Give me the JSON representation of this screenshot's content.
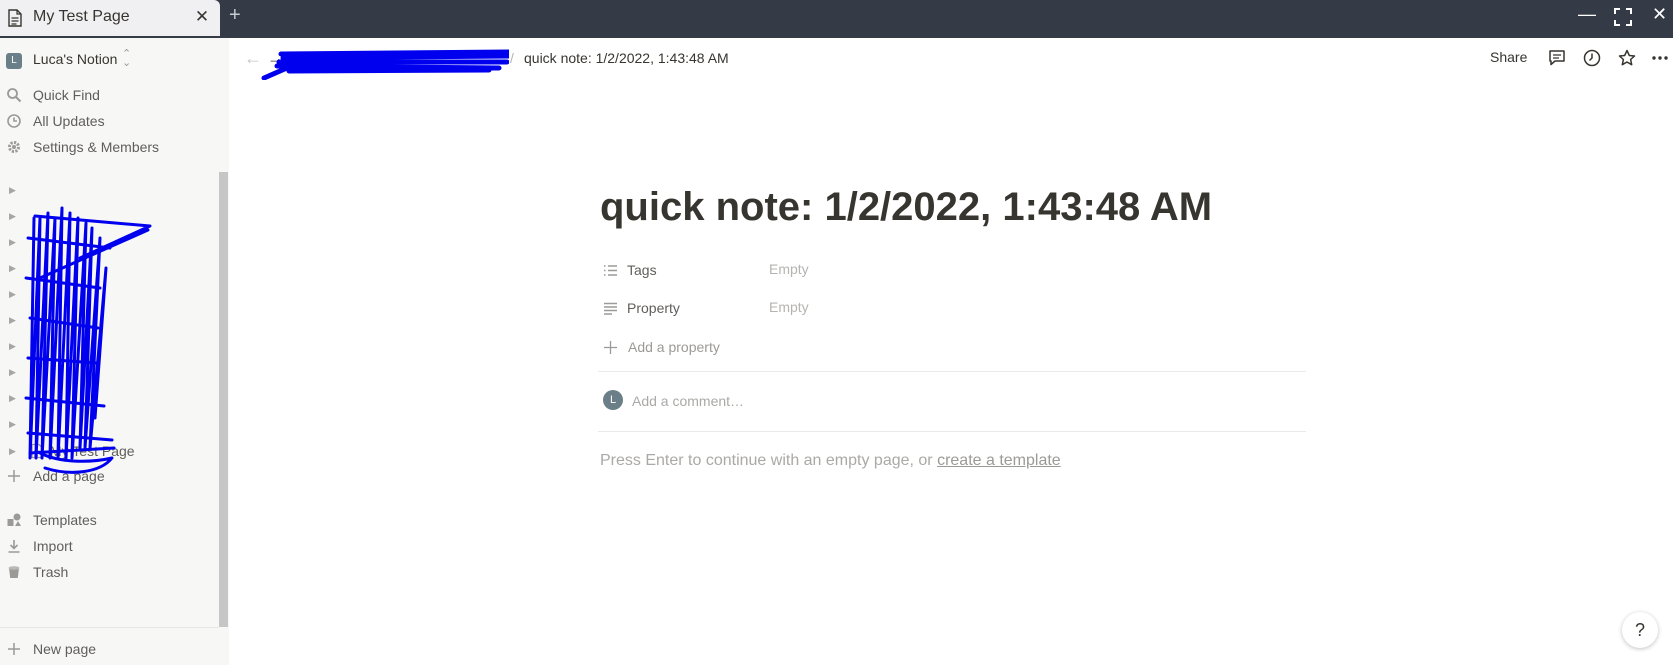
{
  "tabbar": {
    "tab_title": "My Test Page",
    "close_glyph": "✕",
    "new_tab_glyph": "+",
    "window_controls": {
      "minimize": "—",
      "maximize": "⛶",
      "close": "✕"
    }
  },
  "sidebar": {
    "workspace": {
      "avatar_letter": "L",
      "name": "Luca's Notion",
      "switch_icon": "chevron-updown-icon"
    },
    "nav_items": [
      {
        "label": "Quick Find",
        "icon": "search-icon"
      },
      {
        "label": "All Updates",
        "icon": "clock-icon"
      },
      {
        "label": "Settings & Members",
        "icon": "gear-icon"
      }
    ],
    "tree_visible_page": {
      "label": "My Test Page",
      "icon": "page-icon"
    },
    "add_page_label": "Add a page",
    "bottom_items": [
      {
        "label": "Templates",
        "icon": "templates-icon"
      },
      {
        "label": "Import",
        "icon": "import-icon"
      },
      {
        "label": "Trash",
        "icon": "trash-icon"
      }
    ],
    "new_page_label": "New page"
  },
  "topbar": {
    "breadcrumb_separator": "/",
    "breadcrumb_current": "quick note: 1/2/2022, 1:43:48 AM",
    "share_label": "Share"
  },
  "page": {
    "title": "quick note: 1/2/2022, 1:43:48 AM",
    "properties": [
      {
        "name": "Tags",
        "value": "Empty",
        "icon": "list-icon"
      },
      {
        "name": "Property",
        "value": "Empty",
        "icon": "text-lines-icon"
      }
    ],
    "add_property_label": "Add a property",
    "comment": {
      "avatar_letter": "L",
      "placeholder": "Add a comment…"
    },
    "empty_hint_prefix": "Press Enter to continue with an empty page, or",
    "empty_hint_link": "create a template"
  },
  "help_label": "?",
  "colors": {
    "titlebar": "#353a47",
    "sidebar": "#f7f7f5",
    "scribble": "#0000ee",
    "text": "#37352f"
  }
}
